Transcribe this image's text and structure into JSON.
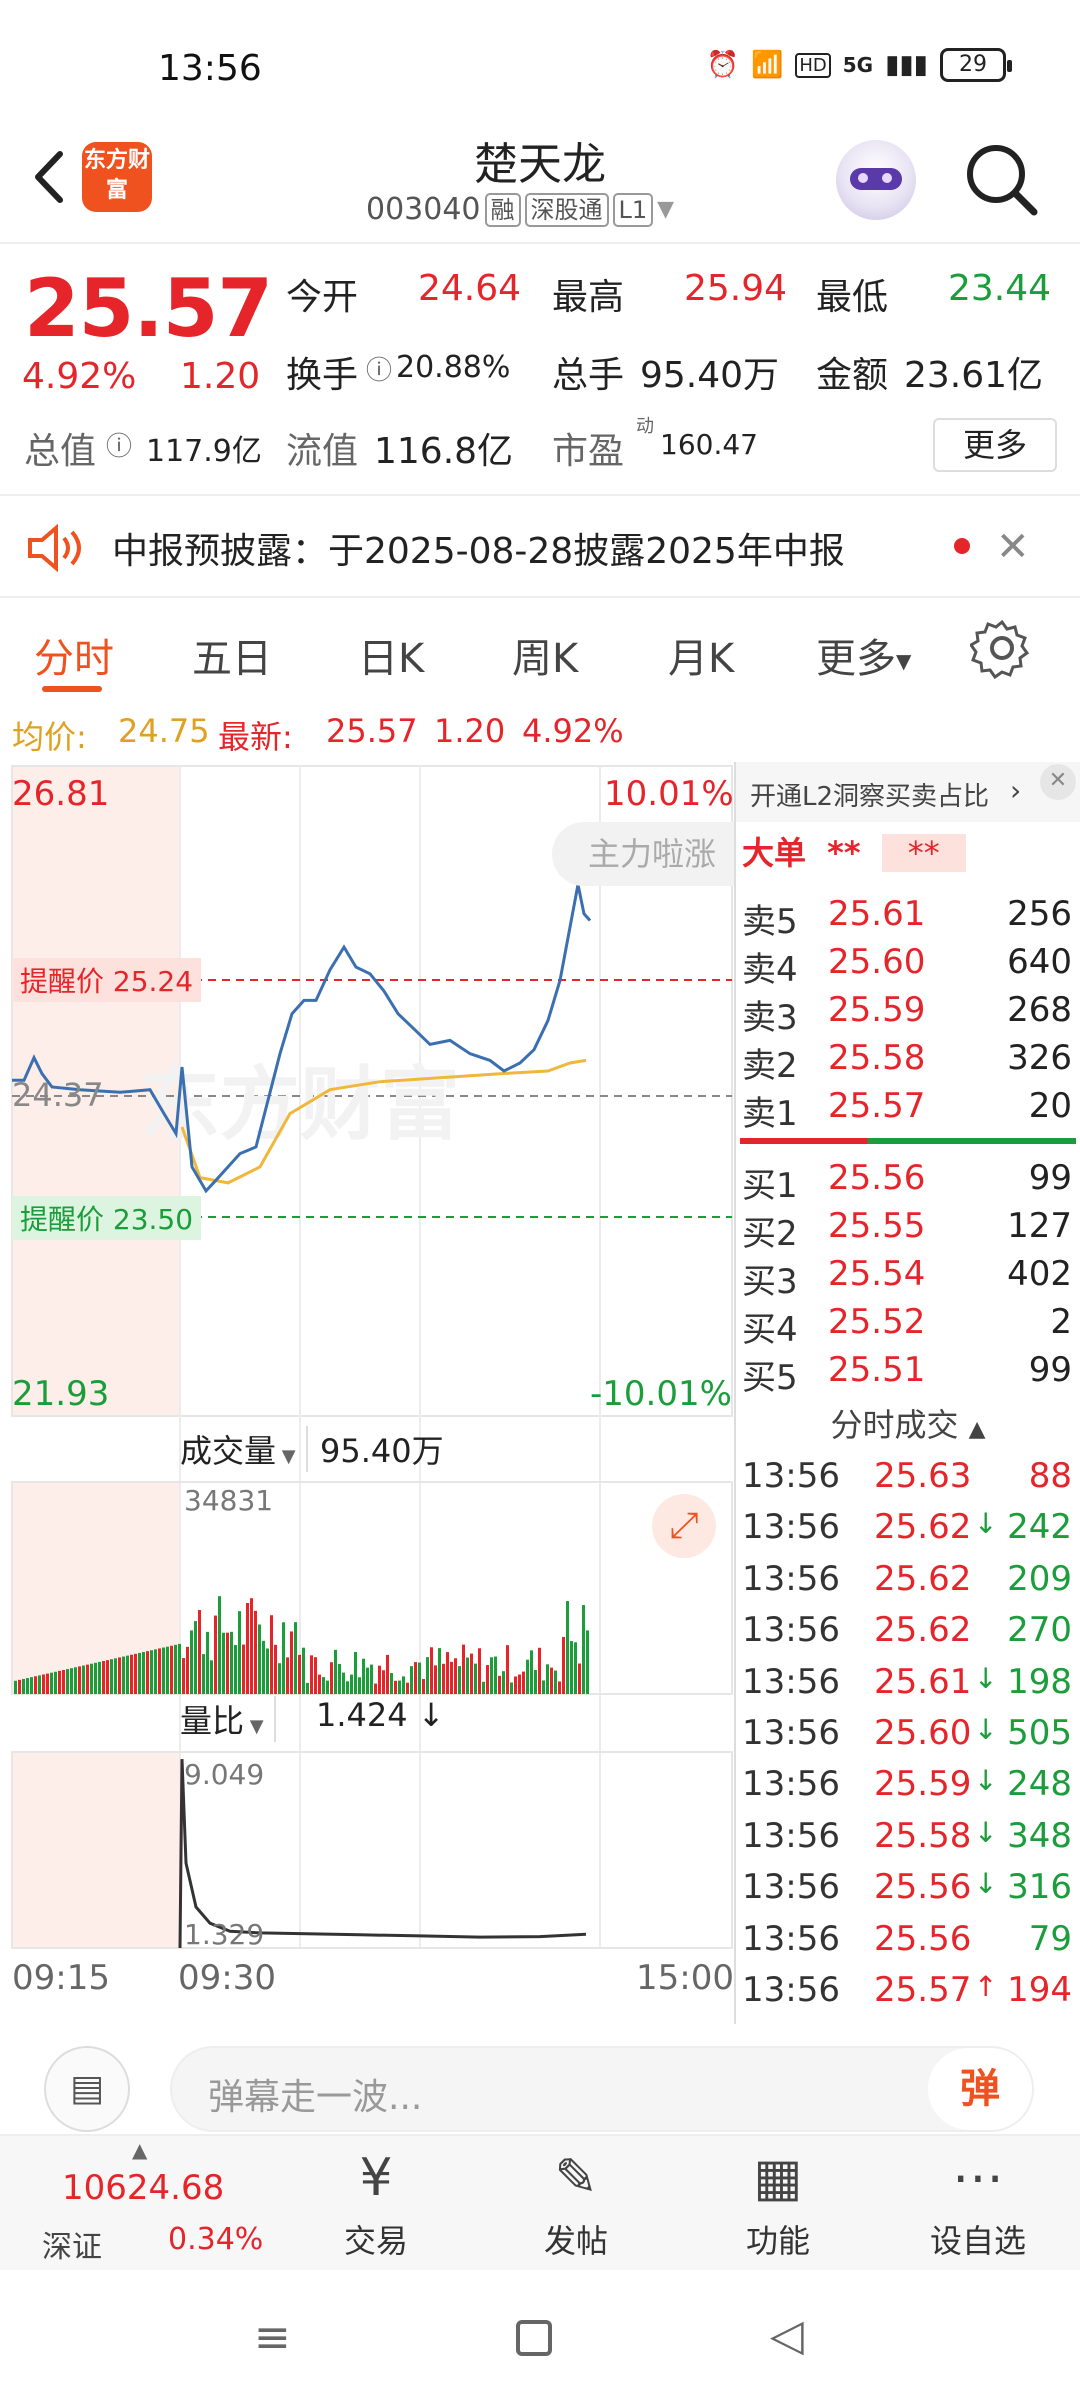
{
  "status": {
    "time": "13:56",
    "network": "5G",
    "battery": "29"
  },
  "header": {
    "title": "楚天龙",
    "code": "003040",
    "tags": [
      "融",
      "深股通",
      "L1"
    ],
    "logo_text": "东方财富"
  },
  "quote": {
    "price": "25.57",
    "change_pct": "4.92%",
    "change": "1.20",
    "open_label": "今开",
    "open": "24.64",
    "high_label": "最高",
    "high": "25.94",
    "low_label": "最低",
    "low": "23.44",
    "turnover_label": "换手",
    "turnover": "20.88%",
    "volume_label": "总手",
    "volume": "95.40万",
    "amount_label": "金额",
    "amount": "23.61亿",
    "mktcap_label": "总值",
    "mktcap": "117.9亿",
    "float_label": "流值",
    "float": "116.8亿",
    "pe_label": "市盈",
    "pe_sup": "动",
    "pe": "160.47",
    "more": "更多"
  },
  "notice": {
    "text": "中报预披露：于2025-08-28披露2025年中报"
  },
  "tabs": [
    "分时",
    "五日",
    "日K",
    "周K",
    "月K",
    "更多"
  ],
  "chart_head": {
    "avg_label": "均价:",
    "avg": "24.75",
    "latest_label": "最新:",
    "latest": "25.57",
    "chg": "1.20",
    "pct": "4.92%"
  },
  "chart": {
    "y_max": "26.81",
    "y_min": "21.93",
    "pct_max": "10.01%",
    "pct_min": "-10.01%",
    "prev_close": "24.37",
    "alert_high": "提醒价 25.24",
    "alert_low": "提醒价 23.50",
    "watermark": "东方财富",
    "tag": "主力啦涨",
    "vol_label": "成交量",
    "vol_total": "95.40万",
    "vol_max": "34831",
    "ratio_label": "量比",
    "ratio_val": "1.424",
    "ratio_max": "9.049",
    "ratio_min": "1.329",
    "x_start": "09:15",
    "x_mid": "09:30",
    "x_end": "15:00"
  },
  "orderbook": {
    "l2_text": "开通L2洞察买卖占比",
    "big_label": "大单",
    "big_stars": "**",
    "big_stars2": "**",
    "asks": [
      {
        "label": "卖5",
        "price": "25.61",
        "vol": "256"
      },
      {
        "label": "卖4",
        "price": "25.60",
        "vol": "640"
      },
      {
        "label": "卖3",
        "price": "25.59",
        "vol": "268"
      },
      {
        "label": "卖2",
        "price": "25.58",
        "vol": "326"
      },
      {
        "label": "卖1",
        "price": "25.57",
        "vol": "20"
      }
    ],
    "bids": [
      {
        "label": "买1",
        "price": "25.56",
        "vol": "99"
      },
      {
        "label": "买2",
        "price": "25.55",
        "vol": "127"
      },
      {
        "label": "买3",
        "price": "25.54",
        "vol": "402"
      },
      {
        "label": "买4",
        "price": "25.52",
        "vol": "2"
      },
      {
        "label": "买5",
        "price": "25.51",
        "vol": "99"
      }
    ],
    "ticks_label": "分时成交",
    "ticks": [
      {
        "time": "13:56",
        "price": "25.63",
        "arrow": "",
        "vol": "88",
        "dir": "buy"
      },
      {
        "time": "13:56",
        "price": "25.62",
        "arrow": "↓",
        "vol": "242",
        "dir": "sell"
      },
      {
        "time": "13:56",
        "price": "25.62",
        "arrow": "",
        "vol": "209",
        "dir": "sell"
      },
      {
        "time": "13:56",
        "price": "25.62",
        "arrow": "",
        "vol": "270",
        "dir": "sell"
      },
      {
        "time": "13:56",
        "price": "25.61",
        "arrow": "↓",
        "vol": "198",
        "dir": "sell"
      },
      {
        "time": "13:56",
        "price": "25.60",
        "arrow": "↓",
        "vol": "505",
        "dir": "sell"
      },
      {
        "time": "13:56",
        "price": "25.59",
        "arrow": "↓",
        "vol": "248",
        "dir": "sell"
      },
      {
        "time": "13:56",
        "price": "25.58",
        "arrow": "↓",
        "vol": "348",
        "dir": "sell"
      },
      {
        "time": "13:56",
        "price": "25.56",
        "arrow": "↓",
        "vol": "316",
        "dir": "sell"
      },
      {
        "time": "13:56",
        "price": "25.56",
        "arrow": "",
        "vol": "79",
        "dir": "sell"
      },
      {
        "time": "13:56",
        "price": "25.57",
        "arrow": "↑",
        "vol": "194",
        "dir": "buy"
      }
    ]
  },
  "comment": {
    "placeholder": "弹幕走一波...",
    "danmu": "弹"
  },
  "bottom_nav": {
    "index_value": "10624.68",
    "index_name": "深证",
    "index_pct": "0.34%",
    "items": [
      "交易",
      "发帖",
      "功能",
      "设自选"
    ]
  },
  "colors": {
    "up": "#e5252a",
    "down": "#1a9d3a",
    "accent": "#f0521f",
    "price_line": "#3b6fb0",
    "avg_line": "#f0b73a"
  }
}
